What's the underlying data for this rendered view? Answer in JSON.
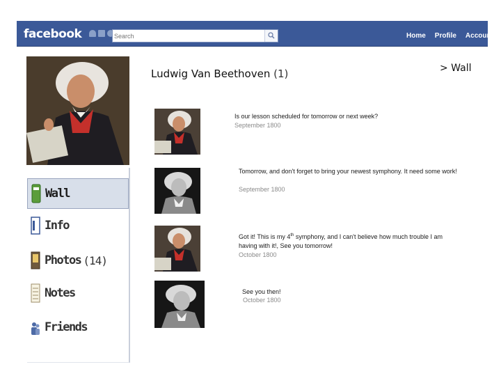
{
  "header": {
    "logo": "facebook",
    "search_placeholder": "Search",
    "nav": [
      "Home",
      "Profile",
      "Account"
    ],
    "accent": "#3b5998"
  },
  "profile": {
    "name": "Ludwig Van Beethoven",
    "count": "(1)",
    "crumb": "> Wall"
  },
  "sidebar": {
    "items": [
      {
        "label": "Wall",
        "icon": "wall-icon",
        "active": true
      },
      {
        "label": "Info",
        "icon": "info-icon"
      },
      {
        "label": "Photos",
        "count": "(14)",
        "icon": "photos-icon"
      },
      {
        "label": "Notes",
        "icon": "notes-icon"
      },
      {
        "label": "Friends",
        "icon": "friends-icon"
      }
    ]
  },
  "posts": [
    {
      "author": "beethoven",
      "text": "Is our lesson scheduled for tomorrow or next week?",
      "date": "September 1800"
    },
    {
      "author": "haydn",
      "text": "Tomorrow, and don't forget to bring your newest symphony.  It need some work!",
      "date": "September 1800"
    },
    {
      "author": "beethoven",
      "text_a": "Got it!  This is my 4",
      "text_sup": "th",
      "text_b": " symphony, and I can't believe how much trouble I am having with it!, See you tomorrow!",
      "date": "October 1800"
    },
    {
      "author": "haydn",
      "text": "See you then!",
      "date": "October 1800"
    }
  ]
}
